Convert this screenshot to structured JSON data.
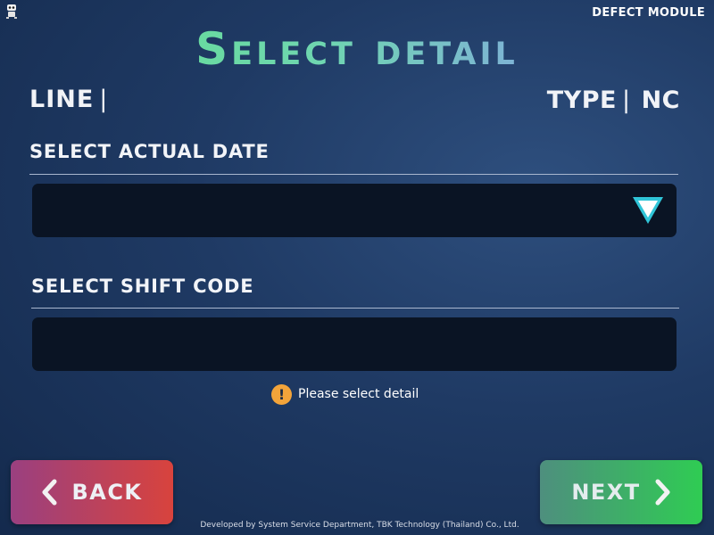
{
  "header": {
    "app_icon": "robot-icon",
    "module_label": "DEFECT MODULE",
    "title": "Select detail"
  },
  "info": {
    "line_label": "LINE",
    "line_separator": "|",
    "line_value": "",
    "type_label": "TYPE",
    "type_separator": "|",
    "type_value": "NC"
  },
  "form": {
    "date_section_title": "SELECT ACTUAL DATE",
    "date_value": "",
    "date_dropdown_icon": "triangle-down-icon",
    "shift_section_title": "SELECT SHIFT CODE",
    "shift_value": ""
  },
  "status": {
    "icon": "warning-icon",
    "icon_glyph": "!",
    "message": "Please select detail"
  },
  "buttons": {
    "back_label": "BACK",
    "next_label": "NEXT"
  },
  "footer": {
    "text": "Developed by System Service Department, TBK Technology (Thailand) Co., Ltd."
  },
  "colors": {
    "background": "#1f3a64",
    "field_background": "#0a1424",
    "back_button_start": "#9a4080",
    "back_button_end": "#d8433d",
    "next_button_start": "#4e8f7e",
    "next_button_end": "#2fcc53",
    "warning": "#f3a43a",
    "title_green": "#5fe08a",
    "dropdown_accent": "#30c5d8"
  }
}
